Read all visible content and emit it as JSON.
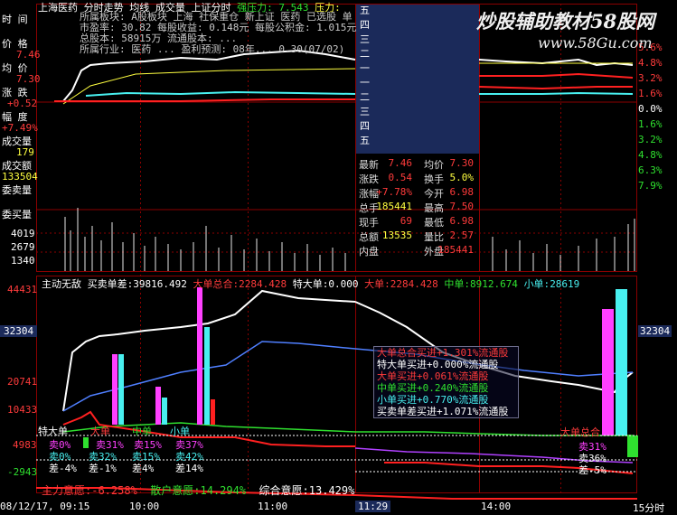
{
  "header": {
    "stock": "上海医药",
    "chart_kind": "分时走势",
    "ma_label": "均线",
    "vol_label": "成交量",
    "index_label": "上证分时",
    "strong_pressure_label": "强压力:",
    "strong_pressure_value": "7.543",
    "pressure_label": "压力:"
  },
  "overlay_info": {
    "line1": "所属板块: A股板块 上海 社保重仓 新上证 医药 已选股 单",
    "line2": "市盈率: 30.82  每股收益: 0.148元  每股公积金: 1.015元",
    "line3": "总股本: 58915万  流通股本: ...",
    "line4": "所属行业: 医药 ... 盈利预测: 08年... 0.30(07/02)"
  },
  "left_labels": {
    "time": "时  间",
    "price": "价  格",
    "price_value": "7.46",
    "avg": "均  价",
    "avg_value": "7.30",
    "change": "涨  跌",
    "change_value": "+0.52",
    "pct": "幅  度",
    "pct_value": "+7.49%",
    "vol": "成交量",
    "vol_value": "179",
    "amount": "成交额",
    "amount_value": "133504",
    "wai": "委卖量",
    "nei": "委买量"
  },
  "order_book": [
    "五",
    "四",
    "三",
    "二",
    "一",
    "一",
    "二",
    "三",
    "四",
    "五"
  ],
  "quote": {
    "last_label": "最新",
    "last": "7.46",
    "avg_label": "均价",
    "avg": "7.30",
    "chg_label": "涨跌",
    "chg": "0.54",
    "turn_label": "换手",
    "turn": "5.0%",
    "pct_label": "涨幅",
    "pct": "+7.78%",
    "open_label": "今开",
    "open": "6.98",
    "vol_label": "总手",
    "vol": "185441",
    "high_label": "最高",
    "high": "7.50",
    "cur_label": "现手",
    "cur": "69",
    "low_label": "最低",
    "low": "6.98",
    "amt_label": "总额",
    "amt": "13535",
    "ratio_label": "量比",
    "ratio": "2.57",
    "in_label": "内盘",
    "in": "",
    "out_label": "外盘",
    "out": "185441"
  },
  "right_axis": [
    "5.6%",
    "4.8%",
    "3.2%",
    "1.6%",
    "0.0%",
    "1.6%",
    "3.2%",
    "4.8%",
    "6.3%",
    "7.9%"
  ],
  "volume_axis": [
    "4019",
    "2679",
    "1340"
  ],
  "indicator_header": {
    "name": "主动无敌",
    "net_label": "买卖单差:",
    "net_value": "39816.492",
    "bigsum_label": "大单总合:",
    "bigsum_value": "2284.428",
    "super_label": "特大单:",
    "super_value": "0.000",
    "big_label": "大单:",
    "big_value": "2284.428",
    "mid_label": "中单:",
    "mid_value": "8912.674",
    "small_label": "小单:",
    "small_value": "28619"
  },
  "lower_axis": [
    "44431",
    "32304",
    "20741",
    "10433",
    "4983",
    "-2943"
  ],
  "lower_axis_right": "32304",
  "legend": [
    {
      "text": "大单总合买进+1.301%流通股",
      "color": "#ff3b3b"
    },
    {
      "text": "特大单买进+0.000%流通股",
      "color": "#ffffff"
    },
    {
      "text": "大单买进+0.061%流通股",
      "color": "#ff3b3b"
    },
    {
      "text": "中单买进+0.240%流通股",
      "color": "#2fe02f"
    },
    {
      "text": "小单买进+0.770%流通股",
      "color": "#48f0f0"
    },
    {
      "text": "买卖单差买进+1.071%流通股",
      "color": "#ffffff"
    }
  ],
  "tab_labels": [
    "特大单",
    "大单",
    "中单",
    "小单"
  ],
  "pct_rows": {
    "sell_a": [
      "卖0%",
      "卖31%",
      "卖15%",
      "卖37%"
    ],
    "buy_a": [
      "卖0%",
      "卖32%",
      "卖15%",
      "卖42%"
    ],
    "diff": [
      "差-4%",
      "差-1%",
      "差4%",
      "差14%"
    ],
    "right_title": "大单总合",
    "right_sell": "卖31%",
    "right_buy": "卖36%",
    "right_diff": "差-5%"
  },
  "footer": {
    "main_label": "主力意愿:",
    "main_value": "-6.258%",
    "retail_label": "散户意愿:",
    "retail_value": "14.294%",
    "total_label": "综合意愿:",
    "total_value": "13.429%"
  },
  "time_axis": {
    "date": "08/12/17, 09:15",
    "t1000": "10:00",
    "t1100": "11:00",
    "t1129": "11:29",
    "t1400": "14:00",
    "end": "15分时"
  },
  "watermark": {
    "text": "炒股辅助教材58股网",
    "url": "www.58Gu.com"
  },
  "colors": {
    "up": "#ff3b3b",
    "down": "#2fe02f",
    "accent": "#ffff40",
    "grid": "#8b0000"
  }
}
